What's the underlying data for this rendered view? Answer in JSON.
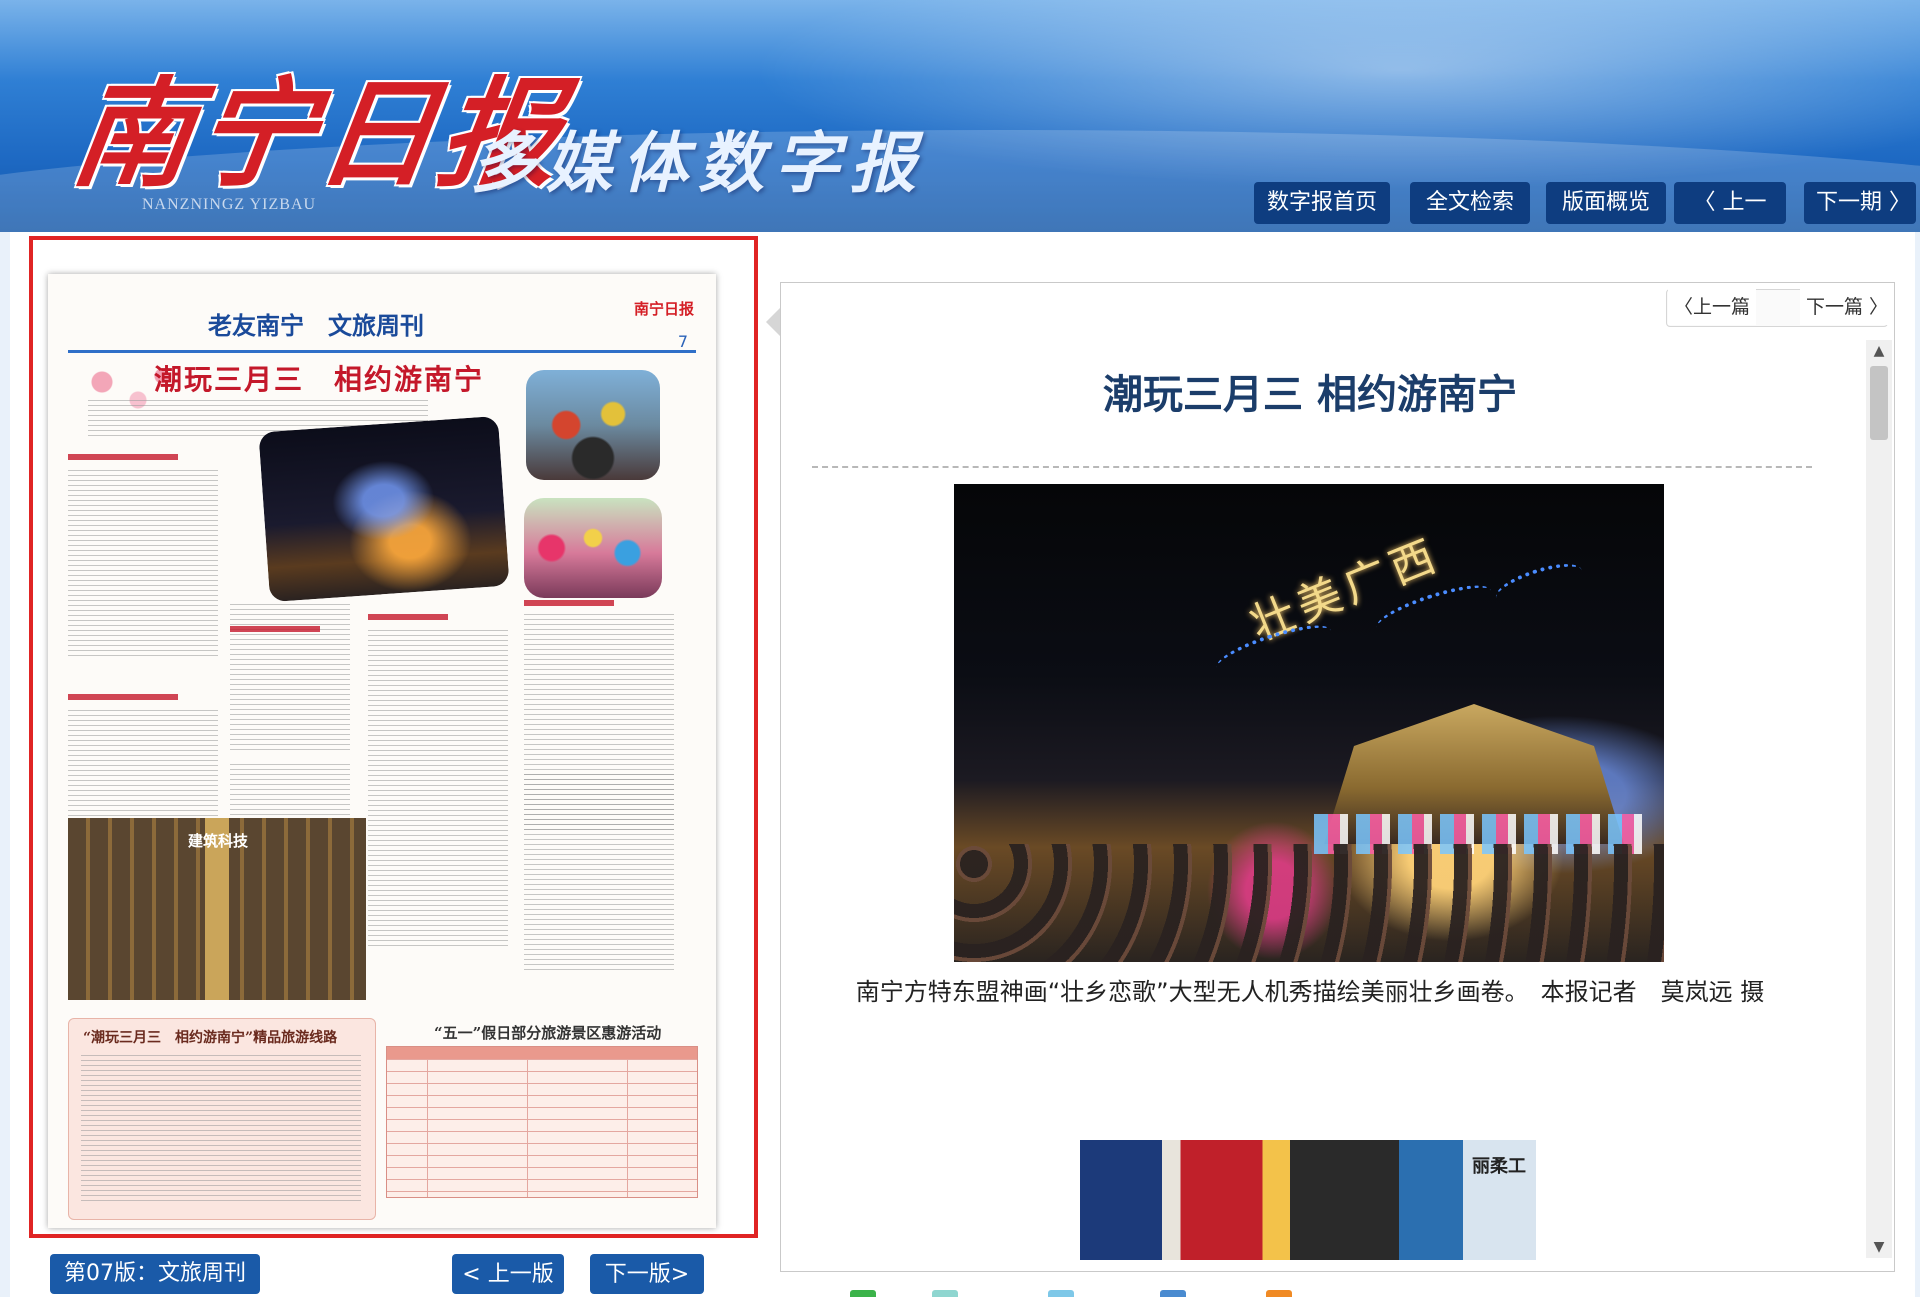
{
  "header": {
    "logo_text": "南宁日报",
    "logo_subtitle": "NANZNINGZ YIZBAU",
    "slogan": "多媒体数字报",
    "nav": [
      "数字报首页",
      "全文检索",
      "版面概览",
      "〈 上一期",
      "下一期 〉"
    ]
  },
  "paper": {
    "masthead": "老友南宁　文旅周刊",
    "page_number": "7",
    "headline": "潮玩三月三　相约游南宁",
    "museum_label": "建筑科技",
    "route_box_title": "“潮玩三月三　相约游南宁”精品旅游线路",
    "table_title": "“五一”假日部分旅游景区惠游活动",
    "logo": "南宁日报"
  },
  "paper_controls": {
    "page_label": "第07版：文旅周刊",
    "prev": "< 上一版",
    "next": "下一版>"
  },
  "article": {
    "prev": "〈上一篇",
    "next": "下一篇 〉",
    "title": "潮玩三月三 相约游南宁",
    "drone_text": "壮美广西",
    "caption": "南宁方特东盟神画“壮乡恋歌”大型无人机秀描绘美丽壮乡画卷。　本报记者　莫岚远 摄",
    "photo2_label": "丽柔工"
  },
  "colors": {
    "header_blue": "#1d68c2",
    "nav_button": "#0e3d80",
    "control_button": "#1a5aa8",
    "frame_red": "#e02424",
    "title_navy": "#1b3d6a"
  }
}
